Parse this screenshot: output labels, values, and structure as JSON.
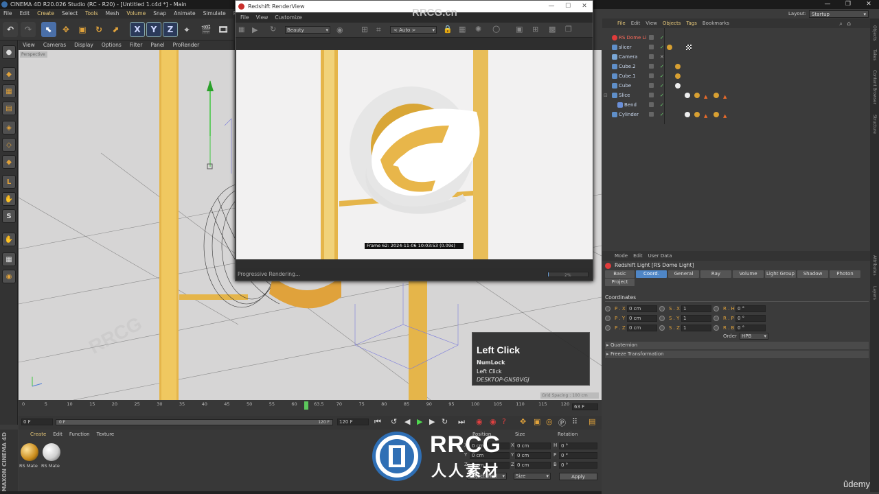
{
  "app": {
    "title": "CINEMA 4D R20.026 Studio (RC - R20) - [Untitled 1.c4d *] - Main",
    "layout_label": "Layout:",
    "layout_value": "Startup",
    "watermark_top": "RRCG.cn",
    "udemy": "ûdemy"
  },
  "menubar": [
    "File",
    "Edit",
    "Create",
    "Select",
    "Tools",
    "Mesh",
    "Volume",
    "Snap",
    "Animate",
    "Simulate",
    "Render"
  ],
  "viewport": {
    "menu": [
      "View",
      "Cameras",
      "Display",
      "Options",
      "Filter",
      "Panel",
      "ProRender"
    ],
    "perspective_label": "Perspective",
    "grid_label": "Grid Spacing : 100 cm"
  },
  "renderview": {
    "title": "Redshift RenderView",
    "menu": [
      "File",
      "View",
      "Customize"
    ],
    "aov": "Beauty",
    "zoom": "< Auto >",
    "frame_info": "Frame  62:  2024-11-06  10:03:53  (0.09s)",
    "status": "Progressive Rendering...",
    "progress_pct": "2%"
  },
  "objects": {
    "menu": [
      "File",
      "Edit",
      "View",
      "Objects",
      "Tags",
      "Bookmarks"
    ],
    "items": [
      {
        "name": "RS Dome Li",
        "color": "#e03b3b"
      },
      {
        "name": "slicer",
        "color": "#5f8fc9"
      },
      {
        "name": "Camera",
        "color": "#7aa7d6"
      },
      {
        "name": "Cube.2",
        "color": "#5f8fc9"
      },
      {
        "name": "Cube.1",
        "color": "#5f8fc9"
      },
      {
        "name": "Cube",
        "color": "#5f8fc9"
      },
      {
        "name": "Slice",
        "color": "#5f8fc9"
      },
      {
        "name": "Bend",
        "color": "#5f8fc9"
      },
      {
        "name": "Cylinder",
        "color": "#5f8fc9"
      }
    ]
  },
  "attributes": {
    "menu": [
      "Mode",
      "Edit",
      "User Data"
    ],
    "title": "Redshift Light [RS Dome Light]",
    "tabs": [
      "Basic",
      "Coord.",
      "General",
      "Ray",
      "Volume",
      "Light Group",
      "Shadow",
      "Photon",
      "Project"
    ],
    "active_tab": "Coord.",
    "section": "Coordinates",
    "pos": [
      {
        "label": "P . X",
        "value": "0 cm"
      },
      {
        "label": "P . Y",
        "value": "0 cm"
      },
      {
        "label": "P . Z",
        "value": "0 cm"
      }
    ],
    "scale": [
      {
        "label": "S . X",
        "value": "1"
      },
      {
        "label": "S . Y",
        "value": "1"
      },
      {
        "label": "S . Z",
        "value": "1"
      }
    ],
    "rot": [
      {
        "label": "R . H",
        "value": "0 °"
      },
      {
        "label": "R . P",
        "value": "0 °"
      },
      {
        "label": "R . B",
        "value": "0 °"
      }
    ],
    "order_label": "Order",
    "order_value": "HPB",
    "collapsed": [
      "Quaternion",
      "Freeze Transformation"
    ]
  },
  "timeline": {
    "ticks": [
      "0",
      "5",
      "10",
      "15",
      "20",
      "25",
      "30",
      "35",
      "40",
      "45",
      "50",
      "55",
      "60",
      "63.5",
      "70",
      "75",
      "80",
      "85",
      "90",
      "95",
      "100",
      "105",
      "110",
      "115",
      "120"
    ],
    "current": "63 F",
    "start": "0 F",
    "end": "120 F",
    "range_start": "0 F",
    "range_end": "120 F"
  },
  "materials": {
    "menu": [
      "Create",
      "Edit",
      "Function",
      "Texture"
    ],
    "items": [
      "RS Mate",
      "RS Mate"
    ],
    "brand": "MAXON CINEMA 4D"
  },
  "coords": {
    "headers": [
      "Position",
      "Size",
      "Rotation"
    ],
    "rows": [
      {
        "axis": "X",
        "pos": "0 cm",
        "size_axis": "X",
        "size": "0 cm",
        "rot_axis": "H",
        "rot": "0 °"
      },
      {
        "axis": "Y",
        "pos": "0 cm",
        "size_axis": "Y",
        "size": "0 cm",
        "rot_axis": "P",
        "rot": "0 °"
      },
      {
        "axis": "Z",
        "pos": "0 cm",
        "size_axis": "Z",
        "size": "0 cm",
        "rot_axis": "B",
        "rot": "0 °"
      }
    ],
    "mode": "Object (Rel)",
    "size_mode": "Size",
    "apply": "Apply"
  },
  "tooltip": {
    "title": "Left Click",
    "key": "NumLock",
    "action": "Left Click",
    "host": "DESKTOP-GN5BVGJ"
  },
  "logo": {
    "big": "RRCG",
    "sub": "人人素材"
  },
  "sidestrip": [
    "Objects",
    "Takes",
    "Content Browser",
    "Structure"
  ],
  "sidestrip2": [
    "Attributes",
    "Layers"
  ],
  "colors": {
    "accent": "#4f86c6",
    "gold": "#e0a23b",
    "panel": "#3b3b3b"
  }
}
